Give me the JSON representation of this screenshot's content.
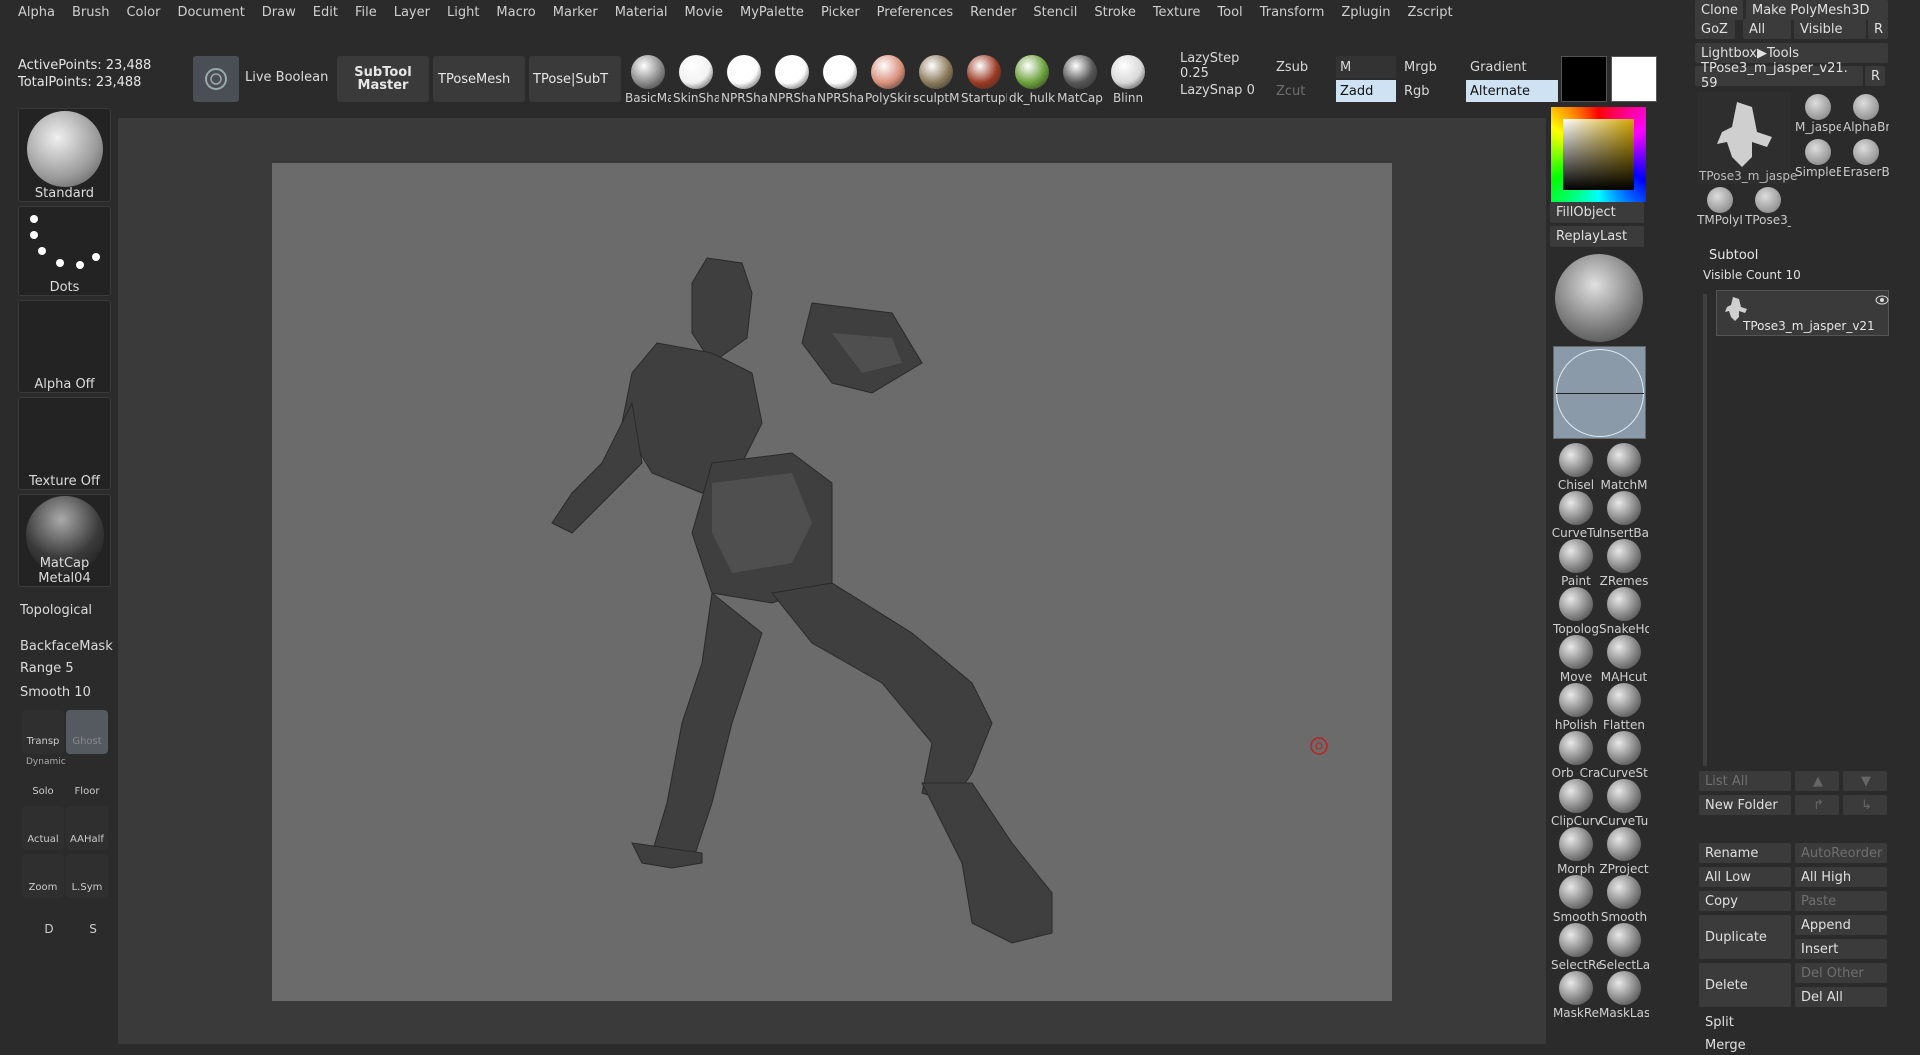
{
  "menu": [
    "Alpha",
    "Brush",
    "Color",
    "Document",
    "Draw",
    "Edit",
    "File",
    "Layer",
    "Light",
    "Macro",
    "Marker",
    "Material",
    "Movie",
    "MyPalette",
    "Picker",
    "Preferences",
    "Render",
    "Stencil",
    "Stroke",
    "Texture",
    "Tool",
    "Transform",
    "Zplugin",
    "Zscript"
  ],
  "stats": {
    "active": "ActivePoints: 23,488",
    "total": "TotalPoints: 23,488"
  },
  "toolbar": {
    "live_boolean": "Live Boolean",
    "subtool_master_1": "SubTool",
    "subtool_master_2": "Master",
    "tposemesh": "TPoseMesh",
    "tpose_subt": "TPose|SubT",
    "materials": [
      {
        "label": "BasicMa",
        "color": "#8a8a8a"
      },
      {
        "label": "SkinSha",
        "color": "#f2f2f2"
      },
      {
        "label": "NPRSha",
        "color": "#ffffff"
      },
      {
        "label": "NPRSha",
        "color": "#ffffff"
      },
      {
        "label": "NPRSha",
        "color": "#ffffff"
      },
      {
        "label": "PolySkin",
        "color": "#d98f7a"
      },
      {
        "label": "sculptM",
        "color": "#8a7a5a"
      },
      {
        "label": "StartupI",
        "color": "#9a3a22"
      },
      {
        "label": "dk_hulk",
        "color": "#6aa03a"
      },
      {
        "label": "MatCap",
        "color": "#555555"
      },
      {
        "label": "Blinn",
        "color": "#d8d8d8"
      }
    ],
    "lazystep": "LazyStep 0.25",
    "lazysnap": "LazySnap 0",
    "zsub": "Zsub",
    "zcut": "Zcut",
    "m": "M",
    "zadd": "Zadd",
    "mrgb": "Mrgb",
    "rgb": "Rgb",
    "gradient": "Gradient",
    "alternate": "Alternate"
  },
  "left": {
    "standard": "Standard",
    "dots": "Dots",
    "alpha_off": "Alpha Off",
    "texture_off": "Texture Off",
    "matcap": "MatCap Metal04",
    "topological": "Topological",
    "backfacemask": "BackfaceMask",
    "range": "Range 5",
    "smooth": "Smooth 10",
    "transp": "Transp",
    "ghost": "Ghost",
    "dynamic": "Dynamic",
    "solo": "Solo",
    "floor": "Floor",
    "actual": "Actual",
    "aahalf": "AAHalf",
    "zoom": "Zoom",
    "lsym": "L.Sym",
    "d": "D",
    "s": "S"
  },
  "mid": {
    "fillobject": "FillObject",
    "replaylast": "ReplayLast",
    "brushes": [
      "Chisel",
      "MatchM",
      "CurveTu",
      "InsertBa",
      "Paint",
      "ZRemes",
      "Topolog",
      "SnakeHo",
      "Move",
      "MAHcut",
      "hPolish",
      "Flatten",
      "Orb_Cra",
      "CurveSt",
      "ClipCurv",
      "CurveTu",
      "Morph",
      "ZProject",
      "Smooth",
      "Smooth",
      "SelectRe",
      "SelectLa",
      "MaskRe",
      "MaskLas"
    ]
  },
  "right": {
    "clone": "Clone",
    "make_polymesh": "Make PolyMesh3D",
    "goz": "GoZ",
    "all": "All",
    "visible": "Visible",
    "r": "R",
    "lightbox_tools": "Lightbox▶Tools",
    "tool_name": "TPose3_m_jasper_v21. 59",
    "tools": [
      "TPose3_m_jaspe",
      "M_jaspe",
      "AlphaBr",
      "SimpleB",
      "EraserB",
      "TMPolyI",
      "TPose3_"
    ],
    "subtool": "Subtool",
    "visible_count": "Visible Count 10",
    "subtool_item": "TPose3_m_jasper_v21",
    "list_all": "List All",
    "new_folder": "New Folder",
    "rename": "Rename",
    "autoreorder": "AutoReorder",
    "all_low": "All Low",
    "all_high": "All High",
    "copy": "Copy",
    "paste": "Paste",
    "duplicate": "Duplicate",
    "append": "Append",
    "insert": "Insert",
    "delete": "Delete",
    "del_other": "Del Other",
    "del_all": "Del All",
    "split": "Split",
    "merge": "Merge"
  }
}
